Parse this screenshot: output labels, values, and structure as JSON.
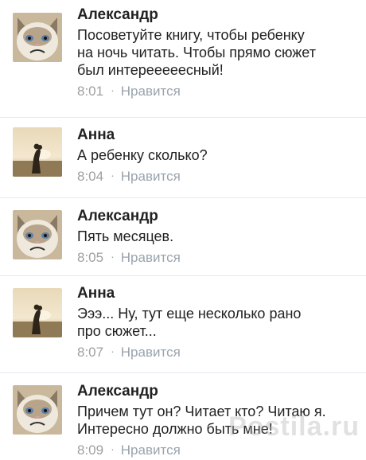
{
  "messages": [
    {
      "author": "Александр",
      "avatar": "grumpy-cat-avatar",
      "lines": [
        "Посоветуйте книгу, чтобы ребенку",
        "на ночь читать. Чтобы прямо сюжет",
        "был интерееееесный!"
      ],
      "time": "8:01",
      "like": "Нравится"
    },
    {
      "author": "Анна",
      "avatar": "couple-sunset-avatar",
      "lines": [
        "А ребенку сколько?"
      ],
      "time": "8:04",
      "like": "Нравится"
    },
    {
      "author": "Александр",
      "avatar": "grumpy-cat-avatar",
      "lines": [
        "Пять месяцев."
      ],
      "time": "8:05",
      "like": "Нравится"
    },
    {
      "author": "Анна",
      "avatar": "couple-sunset-avatar",
      "lines": [
        "Эээ... Ну, тут еще несколько рано",
        "про сюжет..."
      ],
      "time": "8:07",
      "like": "Нравится"
    },
    {
      "author": "Александр",
      "avatar": "grumpy-cat-avatar",
      "lines": [
        "Причем тут он? Читает кто? Читаю я.",
        "Интересно должно быть мне!"
      ],
      "time": "8:09",
      "like": "Нравится"
    }
  ],
  "watermark": "Postila.ru",
  "colors": {
    "author": "#222222",
    "meta": "#a0a0a0",
    "divider": "#e6e9ee"
  }
}
